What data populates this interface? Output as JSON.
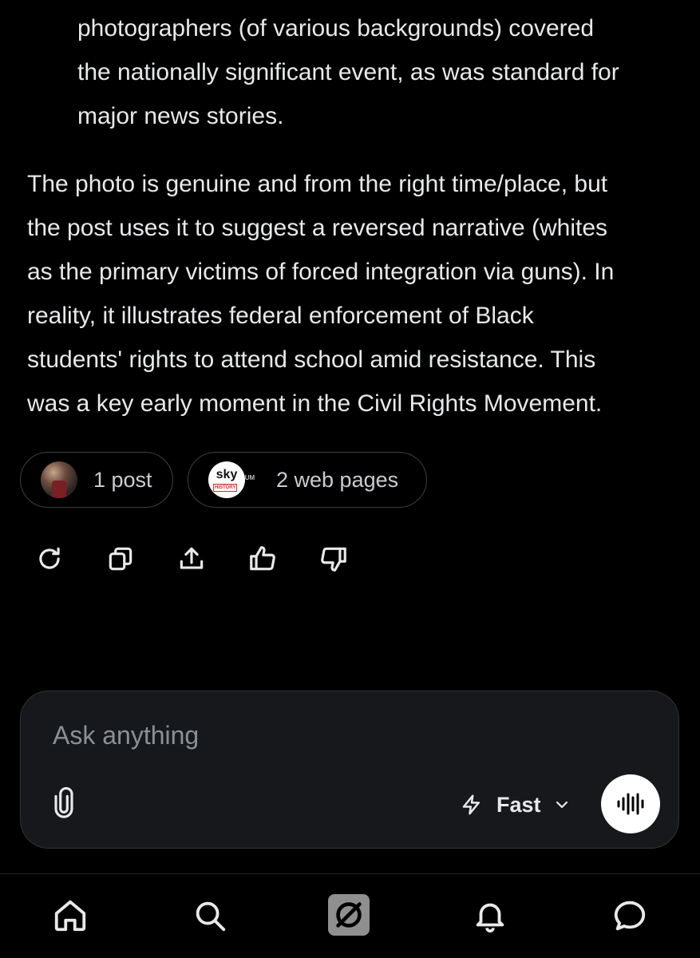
{
  "answer": {
    "bullet_lines": [
      "photographers (of various backgrounds) covered",
      "the nationally significant event, as was standard for",
      "major news stories."
    ],
    "paragraph_lines": [
      "The photo is genuine and from the right time/place, but",
      "the post uses it to suggest a reversed narrative (whites",
      "as the primary victims of forced integration via guns). In",
      "reality, it illustrates federal enforcement of Black",
      "students' rights to attend school amid resistance. This",
      "was a key early moment in the Civil Rights Movement."
    ]
  },
  "sources": {
    "posts_label": "1 post",
    "web_label": "2 web pages",
    "web_logo_text": "sky",
    "web_logo_subtext": "HISTORY",
    "web_logo_secondary": "NUM"
  },
  "actions": [
    {
      "icon": "regenerate-icon"
    },
    {
      "icon": "copy-icon"
    },
    {
      "icon": "share-icon"
    },
    {
      "icon": "thumbs-up-icon"
    },
    {
      "icon": "thumbs-down-icon"
    }
  ],
  "composer": {
    "placeholder": "Ask anything",
    "mode_label": "Fast"
  },
  "nav": [
    {
      "icon": "home-icon"
    },
    {
      "icon": "search-icon"
    },
    {
      "icon": "grok-icon"
    },
    {
      "icon": "notifications-icon"
    },
    {
      "icon": "messages-icon"
    }
  ],
  "colors": {
    "background": "#000000",
    "text": "#e7e9ea",
    "composer_bg": "#16181c",
    "border": "#2f3336"
  }
}
